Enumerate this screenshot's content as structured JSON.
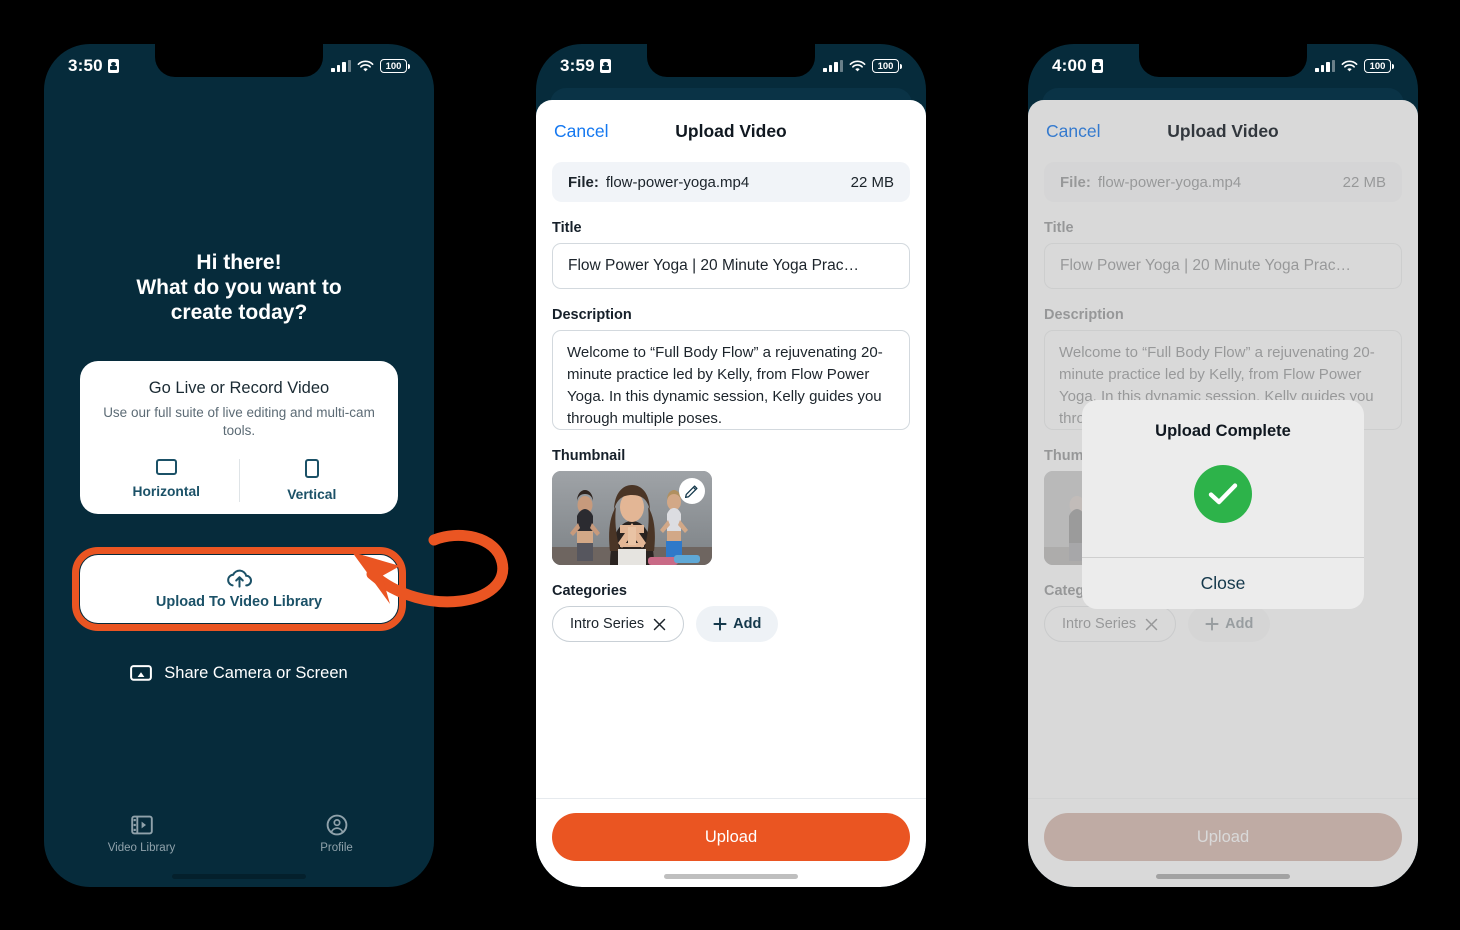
{
  "accent": {
    "orange": "#EA5522",
    "teal": "#062B3B",
    "link_blue": "#1578F0",
    "green": "#2DB34A"
  },
  "phones": [
    {
      "status": {
        "time": "3:50",
        "battery": "100"
      },
      "home": {
        "greeting_line1": "Hi there!",
        "greeting_line2": "What do you want to",
        "greeting_line3": "create today?",
        "live_card": {
          "title": "Go Live or Record Video",
          "subtitle": "Use our full suite of live editing and multi-cam tools.",
          "horizontal_label": "Horizontal",
          "vertical_label": "Vertical"
        },
        "upload_button": "Upload To Video Library",
        "share_label": "Share Camera or Screen",
        "tabs": [
          {
            "label": "Video Library",
            "icon": "film-icon"
          },
          {
            "label": "Profile",
            "icon": "person-circle-icon"
          }
        ]
      }
    },
    {
      "status": {
        "time": "3:59",
        "battery": "100"
      },
      "sheet": {
        "cancel": "Cancel",
        "title": "Upload Video",
        "file_label": "File:",
        "file_name": "flow-power-yoga.mp4",
        "file_size": "22 MB",
        "title_label": "Title",
        "title_value": "Flow Power Yoga  |  20 Minute Yoga Prac…",
        "description_label": "Description",
        "description_value": "Welcome to “Full Body Flow” a rejuvenating 20-minute practice led by Kelly, from Flow Power Yoga. In this dynamic session, Kelly guides you through multiple poses.",
        "thumbnail_label": "Thumbnail",
        "categories_label": "Categories",
        "category_chip": "Intro Series",
        "add_chip": "Add",
        "upload_button": "Upload"
      }
    },
    {
      "status": {
        "time": "4:00",
        "battery": "100"
      },
      "modal": {
        "title": "Upload Complete",
        "close": "Close",
        "icon": "checkmark-circle-icon"
      }
    }
  ]
}
